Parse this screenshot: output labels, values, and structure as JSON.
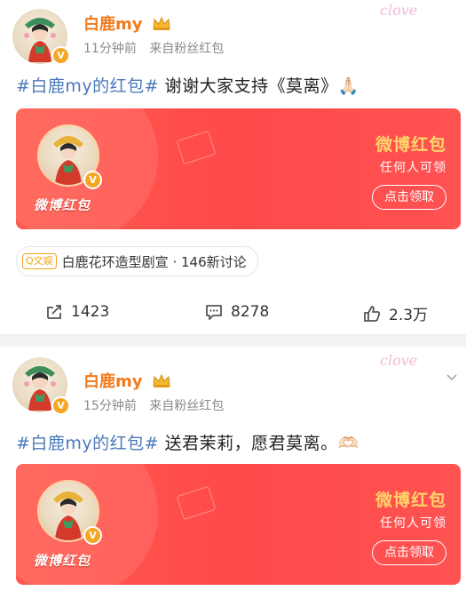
{
  "posts": [
    {
      "user": {
        "name": "白鹿my"
      },
      "meta": {
        "time": "11分钟前",
        "source": "来自粉丝红包"
      },
      "watermark": "clove",
      "content": {
        "tag": "#白鹿my的红包#",
        "text": " 谢谢大家支持《莫离》🙏🏻"
      },
      "redpacket": {
        "label": "微博红包",
        "title": "微博红包",
        "subtitle": "任何人可领",
        "button": "点击领取"
      },
      "topic": {
        "badge": "Q文娱",
        "text": "白鹿花环造型剧宣 · 146新讨论"
      },
      "actions": {
        "repost": "1423",
        "comment": "8278",
        "like": "2.3万"
      }
    },
    {
      "user": {
        "name": "白鹿my"
      },
      "meta": {
        "time": "15分钟前",
        "source": "来自粉丝红包"
      },
      "watermark": "clove",
      "content": {
        "tag": "#白鹿my的红包#",
        "text": " 送君茉莉，愿君莫离。🫶🏻"
      },
      "redpacket": {
        "label": "微博红包",
        "title": "微博红包",
        "subtitle": "任何人可领",
        "button": "点击领取"
      }
    }
  ],
  "colors": {
    "name": "#f27a1a",
    "tag": "#4a78b8",
    "card": "#ff4a4a",
    "title_gold": "#ffd56b"
  }
}
